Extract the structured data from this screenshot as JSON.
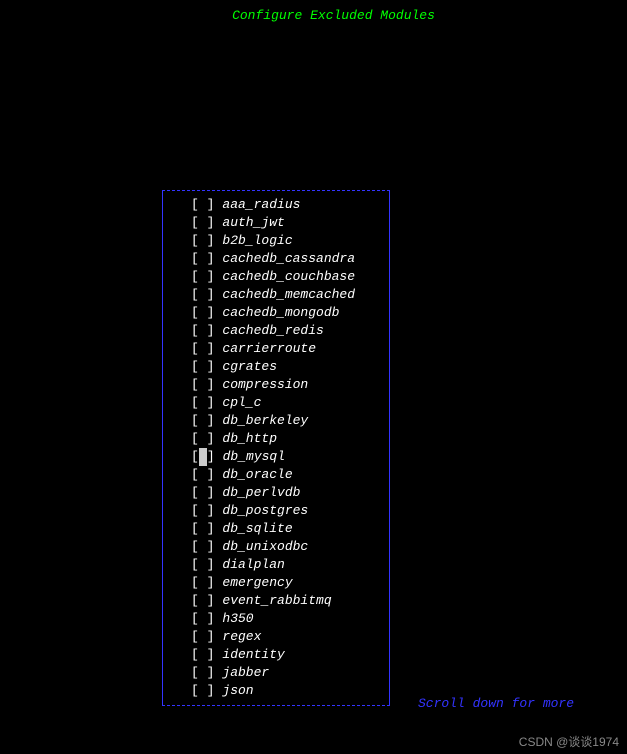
{
  "title": "Configure Excluded Modules",
  "modules": [
    {
      "name": "aaa_radius",
      "checked": false,
      "cursor": false
    },
    {
      "name": "auth_jwt",
      "checked": false,
      "cursor": false
    },
    {
      "name": "b2b_logic",
      "checked": false,
      "cursor": false
    },
    {
      "name": "cachedb_cassandra",
      "checked": false,
      "cursor": false
    },
    {
      "name": "cachedb_couchbase",
      "checked": false,
      "cursor": false
    },
    {
      "name": "cachedb_memcached",
      "checked": false,
      "cursor": false
    },
    {
      "name": "cachedb_mongodb",
      "checked": false,
      "cursor": false
    },
    {
      "name": "cachedb_redis",
      "checked": false,
      "cursor": false
    },
    {
      "name": "carrierroute",
      "checked": false,
      "cursor": false
    },
    {
      "name": "cgrates",
      "checked": false,
      "cursor": false
    },
    {
      "name": "compression",
      "checked": false,
      "cursor": false
    },
    {
      "name": "cpl_c",
      "checked": false,
      "cursor": false
    },
    {
      "name": "db_berkeley",
      "checked": false,
      "cursor": false
    },
    {
      "name": "db_http",
      "checked": false,
      "cursor": false
    },
    {
      "name": "db_mysql",
      "checked": false,
      "cursor": true
    },
    {
      "name": "db_oracle",
      "checked": false,
      "cursor": false
    },
    {
      "name": "db_perlvdb",
      "checked": false,
      "cursor": false
    },
    {
      "name": "db_postgres",
      "checked": false,
      "cursor": false
    },
    {
      "name": "db_sqlite",
      "checked": false,
      "cursor": false
    },
    {
      "name": "db_unixodbc",
      "checked": false,
      "cursor": false
    },
    {
      "name": "dialplan",
      "checked": false,
      "cursor": false
    },
    {
      "name": "emergency",
      "checked": false,
      "cursor": false
    },
    {
      "name": "event_rabbitmq",
      "checked": false,
      "cursor": false
    },
    {
      "name": "h350",
      "checked": false,
      "cursor": false
    },
    {
      "name": "regex",
      "checked": false,
      "cursor": false
    },
    {
      "name": "identity",
      "checked": false,
      "cursor": false
    },
    {
      "name": "jabber",
      "checked": false,
      "cursor": false
    },
    {
      "name": "json",
      "checked": false,
      "cursor": false
    }
  ],
  "scroll_hint": "Scroll down for more",
  "watermark": "CSDN @谈谈1974"
}
